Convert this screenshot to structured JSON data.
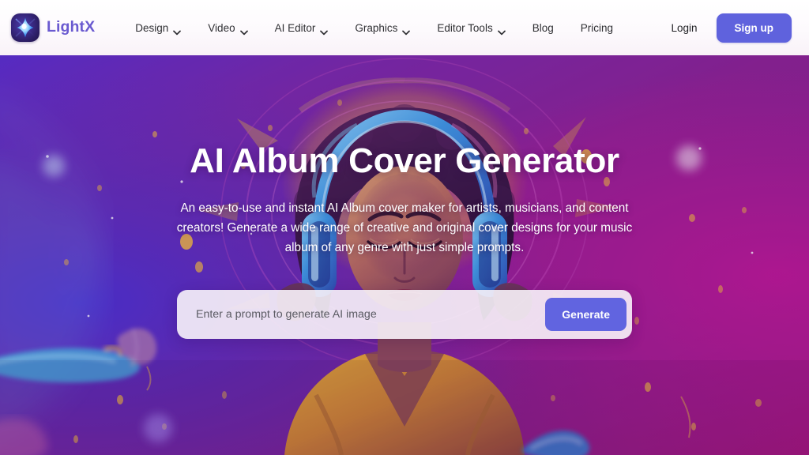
{
  "brand": {
    "name": "LightX",
    "logo_icon": "spark-star-icon",
    "logo_accent_color": "#6a5ad0"
  },
  "nav": {
    "items": [
      {
        "label": "Design",
        "has_dropdown": true,
        "icon": "chevron-down-icon"
      },
      {
        "label": "Video",
        "has_dropdown": true,
        "icon": "chevron-down-icon"
      },
      {
        "label": "AI Editor",
        "has_dropdown": true,
        "icon": "chevron-down-icon"
      },
      {
        "label": "Graphics",
        "has_dropdown": true,
        "icon": "chevron-down-icon"
      },
      {
        "label": "Editor Tools",
        "has_dropdown": true,
        "icon": "chevron-down-icon"
      },
      {
        "label": "Blog",
        "has_dropdown": false,
        "icon": ""
      },
      {
        "label": "Pricing",
        "has_dropdown": false,
        "icon": ""
      }
    ]
  },
  "auth": {
    "login_label": "Login",
    "signup_label": "Sign up",
    "signup_color": "#5f62dd"
  },
  "hero": {
    "title": "AI Album Cover Generator",
    "subtitle": "An easy-to-use and instant AI Album cover maker for artists, musicians, and content creators! Generate a wide range of creative and original cover designs for your music album of any genre with just simple prompts.",
    "background_description": "AI-generated album cover art: woman with blue headphones and curly hair against purple, magenta and gold swirling abstract background with paint splashes and sparkle particles"
  },
  "prompt": {
    "placeholder": "Enter a prompt to generate AI image",
    "value": "",
    "generate_label": "Generate",
    "generate_color": "#6164e0"
  }
}
